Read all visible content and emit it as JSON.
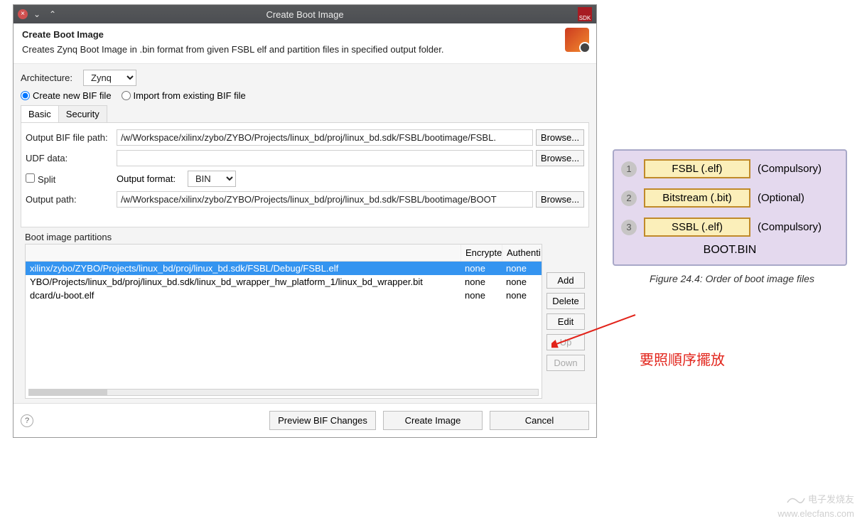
{
  "titlebar": {
    "title": "Create Boot Image"
  },
  "banner": {
    "title": "Create Boot Image",
    "desc": "Creates Zynq Boot Image in .bin format from given FSBL elf and partition files in specified output folder."
  },
  "arch": {
    "label": "Architecture:",
    "value": "Zynq"
  },
  "bif_mode": {
    "create": "Create new BIF file",
    "import": "Import from existing BIF file"
  },
  "tabs": {
    "basic": "Basic",
    "security": "Security"
  },
  "fields": {
    "bif_path_label": "Output BIF file path:",
    "bif_path": "/w/Workspace/xilinx/zybo/ZYBO/Projects/linux_bd/proj/linux_bd.sdk/FSBL/bootimage/FSBL.",
    "udf_label": "UDF data:",
    "udf": "",
    "split_label": "Split",
    "ofmt_label": "Output format:",
    "ofmt": "BIN",
    "out_path_label": "Output path:",
    "out_path": "/w/Workspace/xilinx/zybo/ZYBO/Projects/linux_bd/proj/linux_bd.sdk/FSBL/bootimage/BOOT",
    "browse": "Browse..."
  },
  "partitions": {
    "section_label": "Boot image partitions",
    "headers": {
      "path": "",
      "enc": "Encrypte",
      "auth": "Authenti"
    },
    "rows": [
      {
        "path": "xilinx/zybo/ZYBO/Projects/linux_bd/proj/linux_bd.sdk/FSBL/Debug/FSBL.elf",
        "enc": "none",
        "auth": "none",
        "selected": true
      },
      {
        "path": "YBO/Projects/linux_bd/proj/linux_bd.sdk/linux_bd_wrapper_hw_platform_1/linux_bd_wrapper.bit",
        "enc": "none",
        "auth": "none",
        "selected": false
      },
      {
        "path": "dcard/u-boot.elf",
        "enc": "none",
        "auth": "none",
        "selected": false
      }
    ],
    "buttons": {
      "add": "Add",
      "delete": "Delete",
      "edit": "Edit",
      "up": "Up",
      "down": "Down"
    }
  },
  "footer": {
    "preview": "Preview BIF Changes",
    "create": "Create Image",
    "cancel": "Cancel"
  },
  "diagram": {
    "rows": [
      {
        "n": "1",
        "box": "FSBL  (.elf)",
        "tag": "(Compulsory)"
      },
      {
        "n": "2",
        "box": "Bitstream  (.bit)",
        "tag": "(Optional)"
      },
      {
        "n": "3",
        "box": "SSBL  (.elf)",
        "tag": "(Compulsory)"
      }
    ],
    "bootbin": "BOOT.BIN",
    "caption": "Figure 24.4:  Order of boot image files"
  },
  "annotation": "要照順序擺放",
  "watermark": {
    "zh": "电子发烧友",
    "url": "www.elecfans.com"
  }
}
